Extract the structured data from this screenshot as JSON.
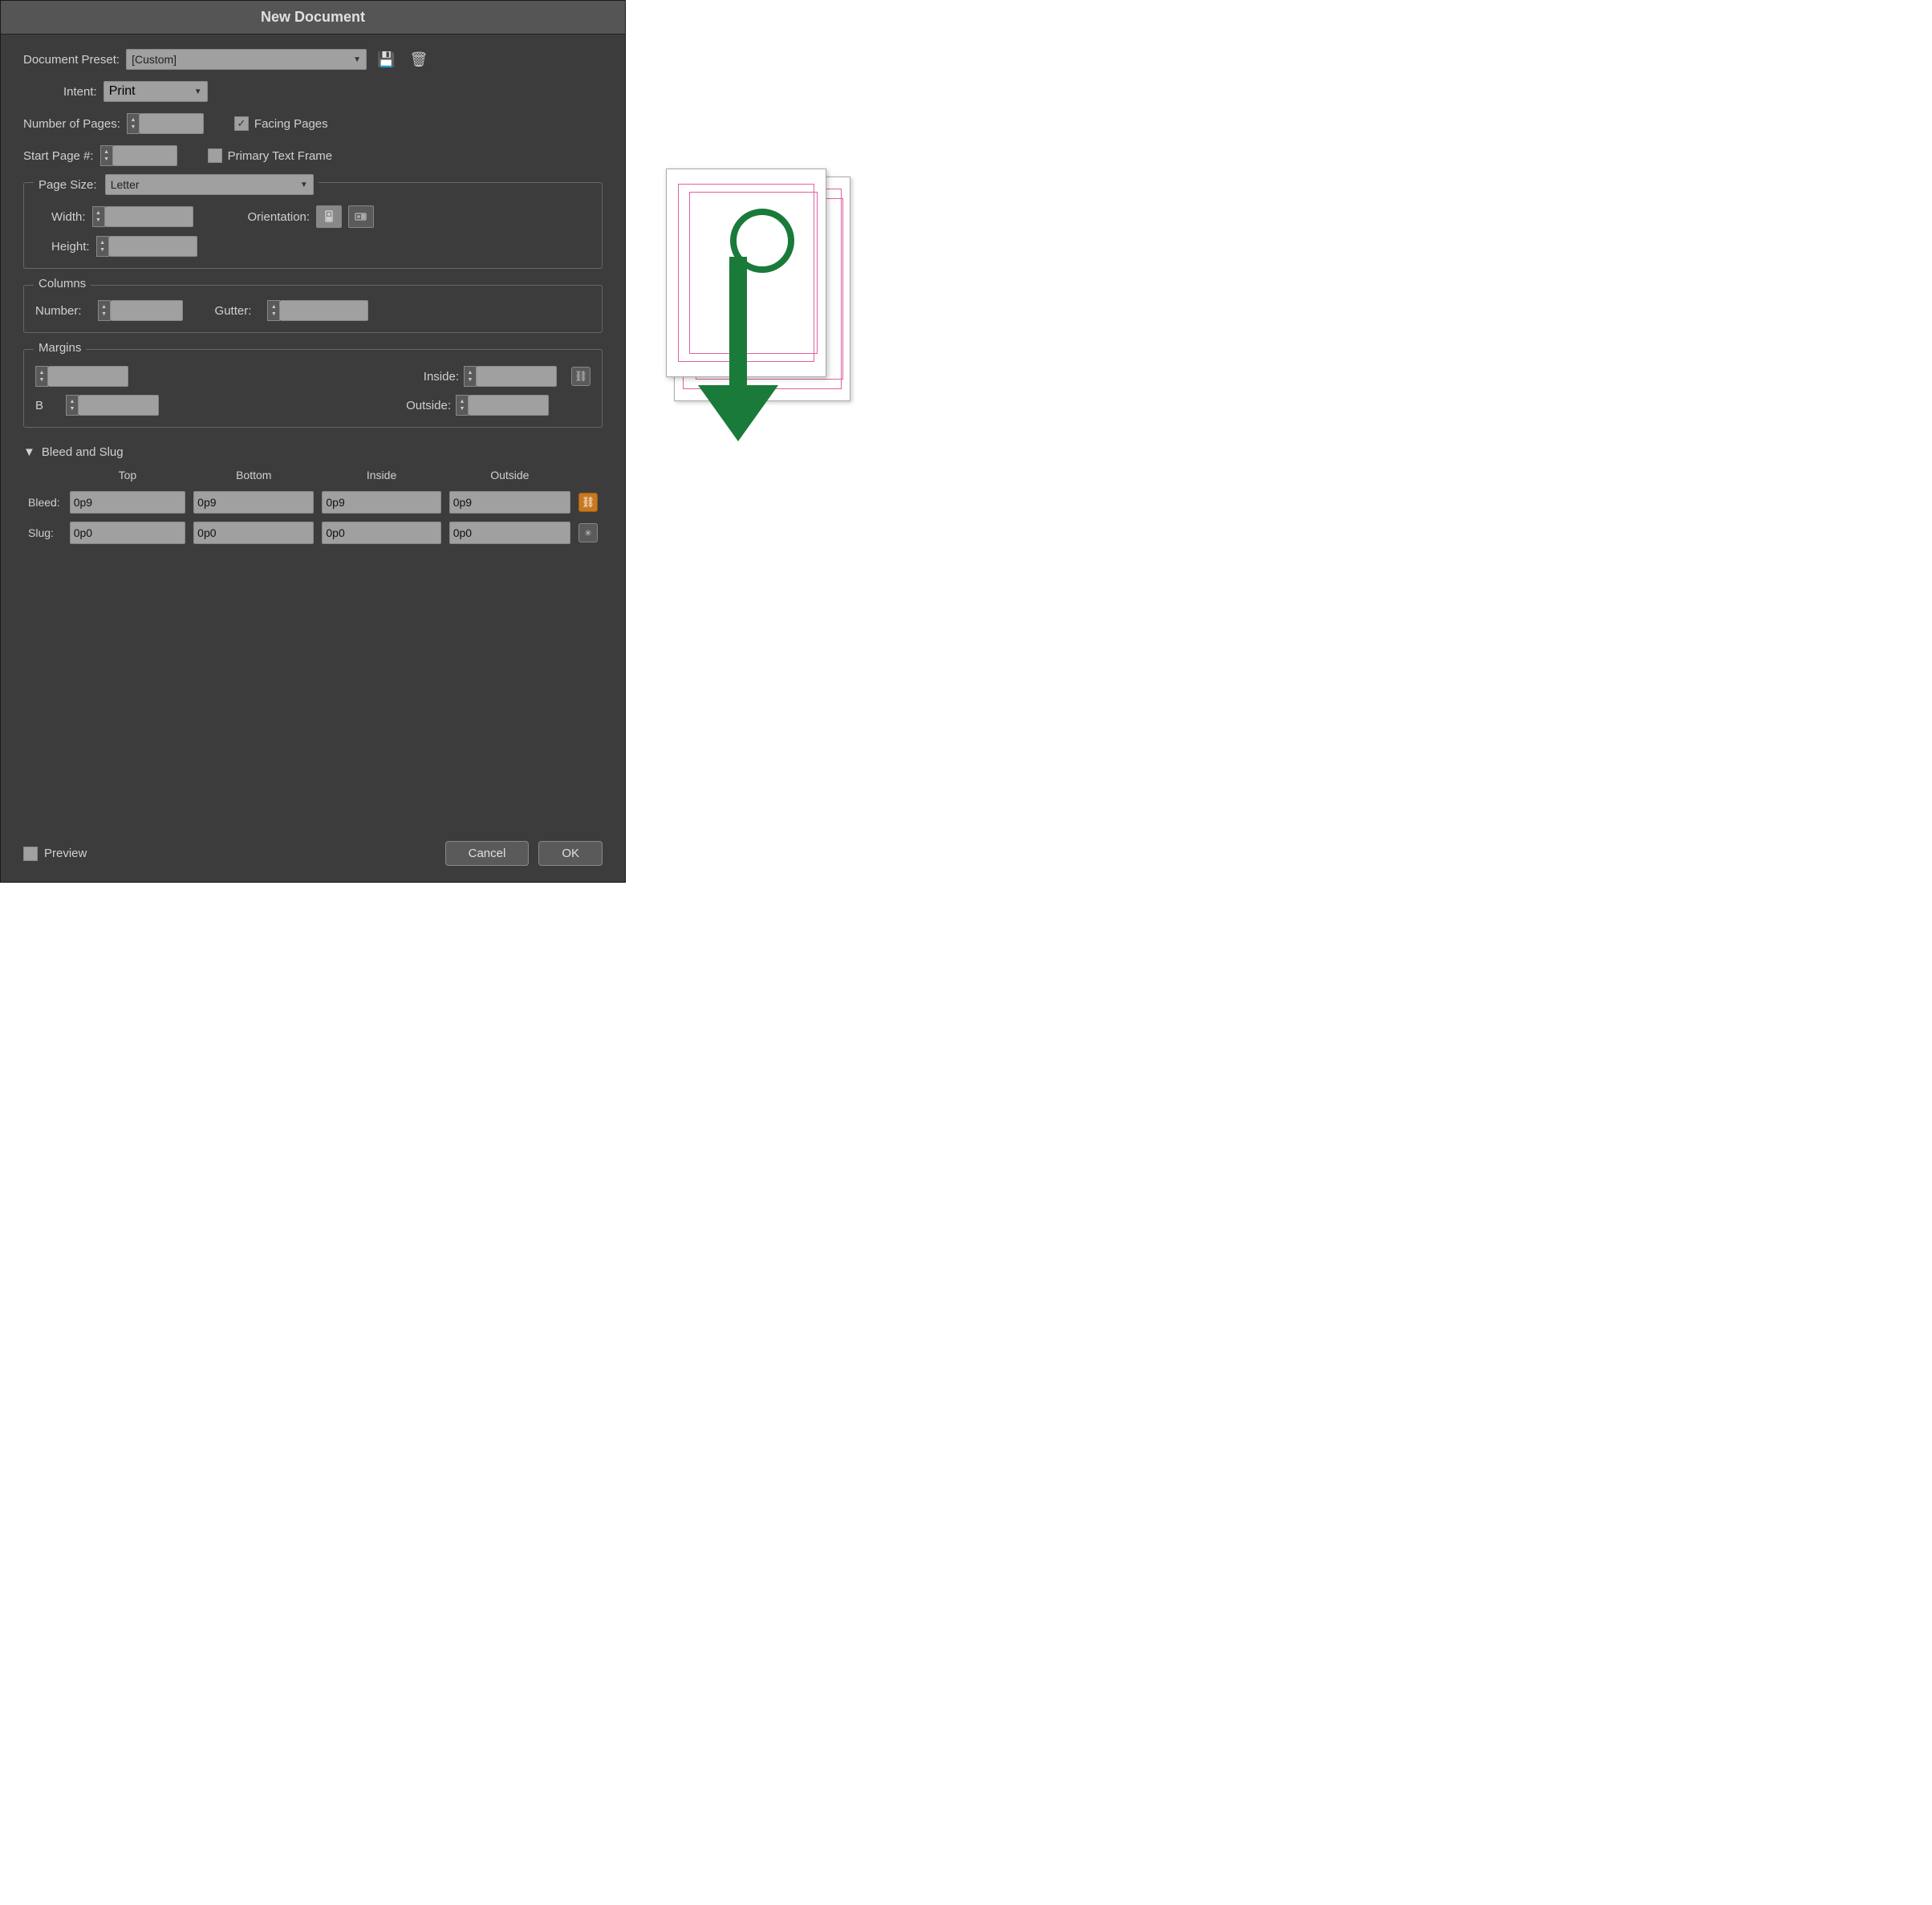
{
  "dialog": {
    "title": "New Document",
    "preset": {
      "label": "Document Preset:",
      "value": "[Custom]",
      "save_icon": "💾",
      "delete_icon": "🗑"
    },
    "intent": {
      "label": "Intent:",
      "value": "Print"
    },
    "num_pages": {
      "label": "Number of Pages:"
    },
    "facing_pages": {
      "label": "Facing Pages",
      "checked": true,
      "check_mark": "✓"
    },
    "start_page": {
      "label": "Start Page #:"
    },
    "primary_text_frame": {
      "label": "Primary Text Frame",
      "checked": false
    },
    "page_size": {
      "group_label": "Page Size:",
      "value": "Letter"
    },
    "width": {
      "label": "Width:"
    },
    "height": {
      "label": "Height:"
    },
    "orientation": {
      "label": "Orientation:",
      "portrait": "🧍",
      "landscape": "🔄"
    },
    "columns": {
      "group_label": "Columns",
      "number_label": "Number:",
      "gutter_label": "Gutter:"
    },
    "margins": {
      "group_label": "Margins",
      "top_label": "",
      "inside_label": "Inside:",
      "bottom_label": "",
      "outside_label": "Outside:"
    },
    "bleed_slug": {
      "collapse_icon": "▼",
      "label": "Bleed and Slug",
      "col_top": "Top",
      "col_bottom": "Bottom",
      "col_inside": "Inside",
      "col_outside": "Outside",
      "bleed_label": "Bleed:",
      "bleed_top": "0p9",
      "bleed_bottom": "0p9",
      "bleed_inside": "0p9",
      "bleed_outside": "0p9",
      "slug_label": "Slug:",
      "slug_top": "0p0",
      "slug_bottom": "0p0",
      "slug_inside": "0p0",
      "slug_outside": "0p0"
    },
    "footer": {
      "preview_label": "Preview",
      "cancel_label": "Cancel",
      "ok_label": "OK"
    }
  },
  "arrow": {
    "color": "#1a7a3a"
  }
}
